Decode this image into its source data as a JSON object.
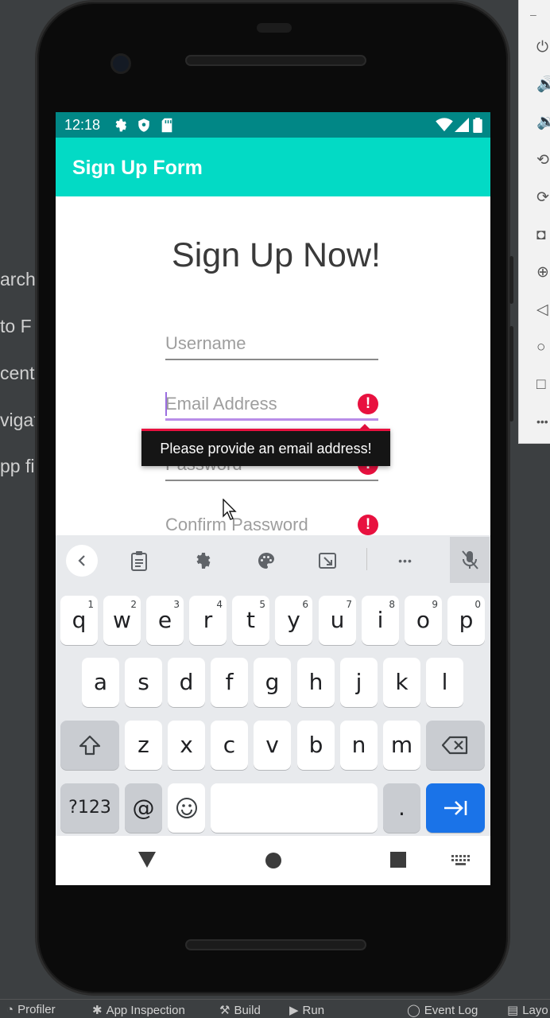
{
  "ide": {
    "left_items": [
      "arch",
      "to F",
      "cent",
      "vigat",
      "pp fil"
    ],
    "right_panel_icons": [
      "power-icon",
      "volume-up-icon",
      "volume-down-icon",
      "rotate-left-icon",
      "rotate-right-icon",
      "camera-icon",
      "zoom-icon",
      "back-icon",
      "home-icon",
      "overview-icon",
      "more-icon"
    ],
    "right_panel_top": "–",
    "bottom_tabs": [
      "Profiler",
      "App Inspection",
      "Build",
      "Run",
      "Event Log",
      "Layo"
    ]
  },
  "status_bar": {
    "time": "12:18"
  },
  "app_bar": {
    "title": "Sign Up Form"
  },
  "form": {
    "heading": "Sign Up Now!",
    "username_placeholder": "Username",
    "email_placeholder": "Email Address",
    "password_placeholder": "Password",
    "confirm_placeholder": "Confirm Password",
    "error_tooltip": "Please provide an email address!",
    "error_glyph": "!"
  },
  "keyboard": {
    "row1": [
      {
        "key": "q",
        "hint": "1"
      },
      {
        "key": "w",
        "hint": "2"
      },
      {
        "key": "e",
        "hint": "3"
      },
      {
        "key": "r",
        "hint": "4"
      },
      {
        "key": "t",
        "hint": "5"
      },
      {
        "key": "y",
        "hint": "6"
      },
      {
        "key": "u",
        "hint": "7"
      },
      {
        "key": "i",
        "hint": "8"
      },
      {
        "key": "o",
        "hint": "9"
      },
      {
        "key": "p",
        "hint": "0"
      }
    ],
    "row2": [
      "a",
      "s",
      "d",
      "f",
      "g",
      "h",
      "j",
      "k",
      "l"
    ],
    "row3": [
      "z",
      "x",
      "c",
      "v",
      "b",
      "n",
      "m"
    ],
    "symbols_label": "?123",
    "at_label": "@",
    "period_label": ".",
    "toolbar_more": "•••"
  },
  "colors": {
    "status_bar": "#018786",
    "app_bar": "#03dac5",
    "error": "#e8113f",
    "focus_underline": "#b98de8",
    "enter_key": "#1a73e8"
  }
}
